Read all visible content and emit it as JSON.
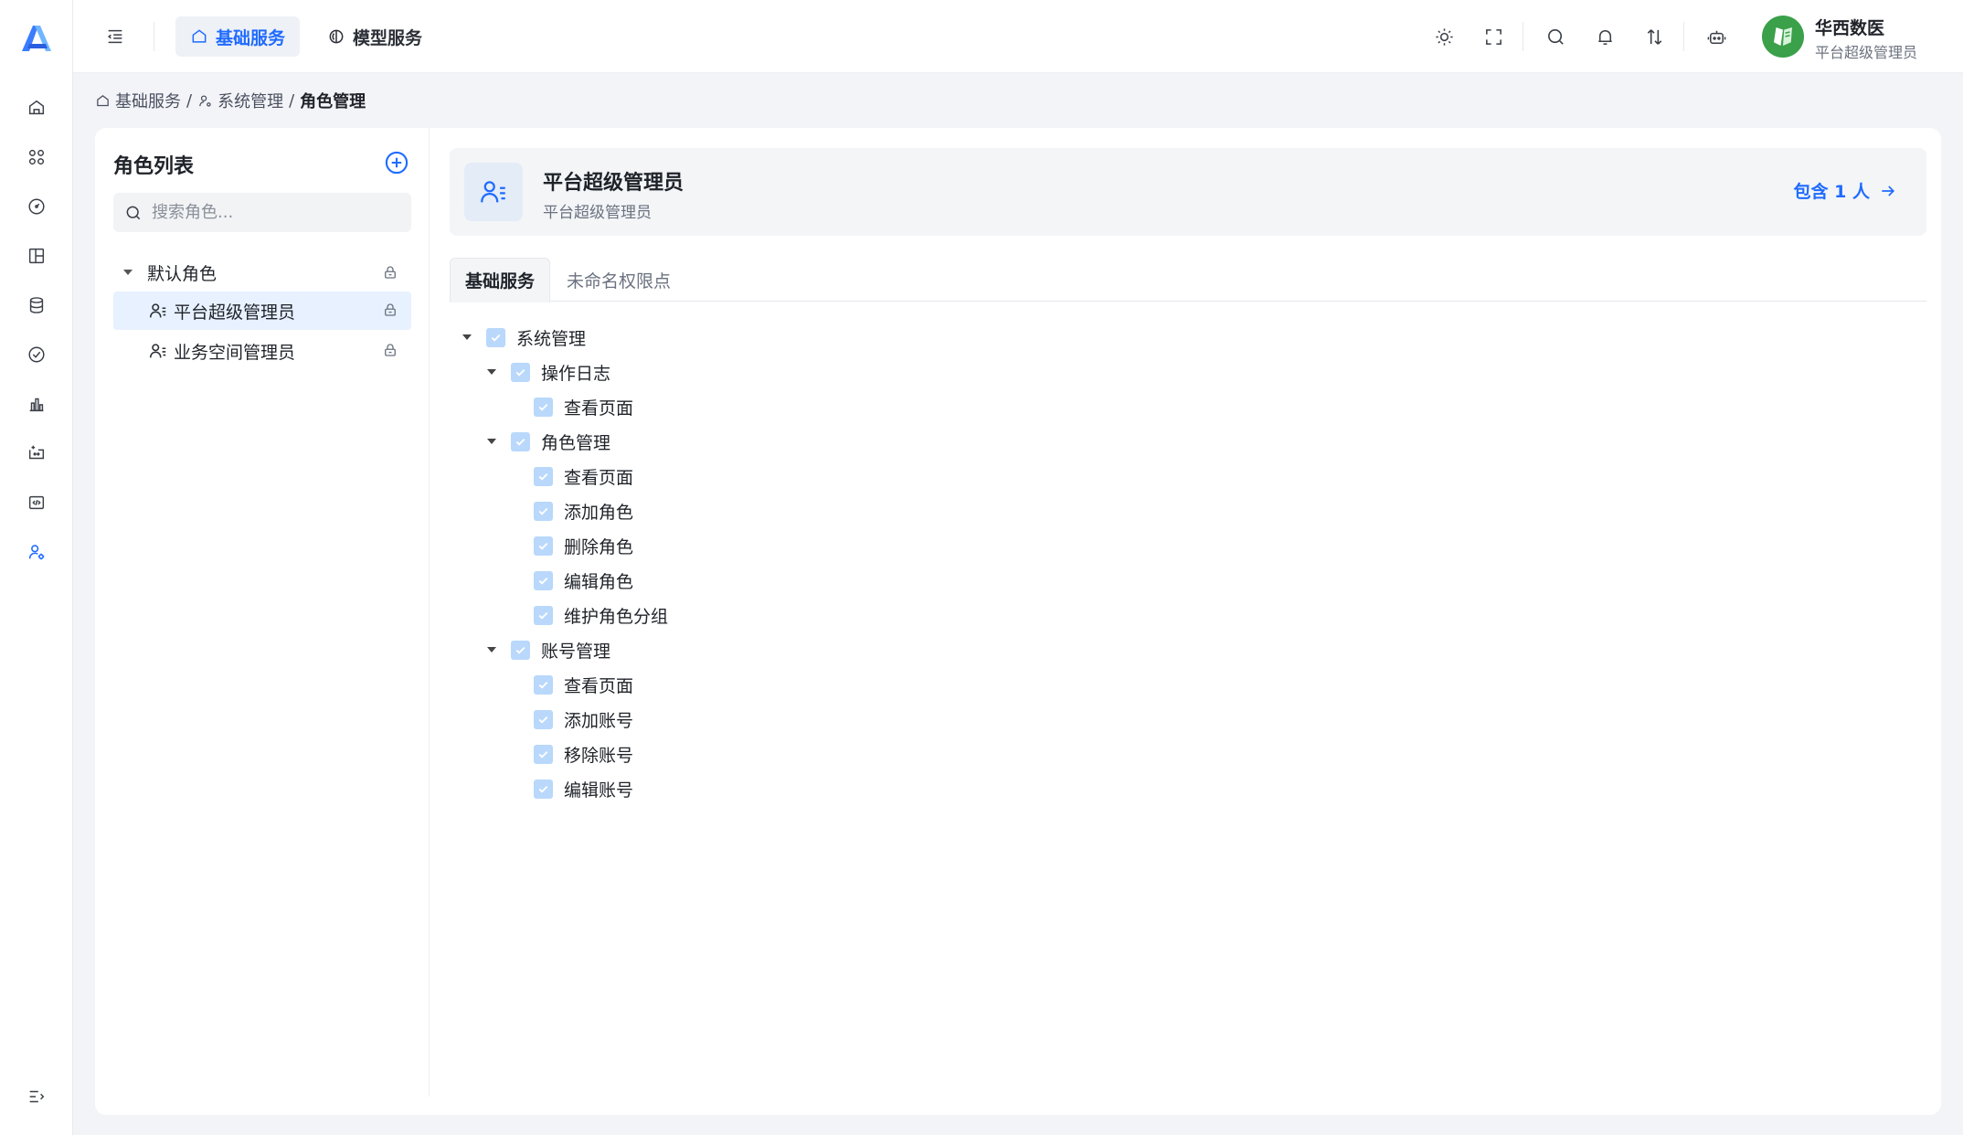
{
  "header": {
    "top_tabs": [
      {
        "label": "基础服务",
        "active": true
      },
      {
        "label": "模型服务",
        "active": false
      }
    ],
    "user": {
      "name": "华西数医",
      "role": "平台超级管理员"
    }
  },
  "breadcrumb": [
    "基础服务",
    "系统管理",
    "角色管理"
  ],
  "sidebar": {
    "icons": [
      "home-icon",
      "apps-icon",
      "dashboard-icon",
      "layout-icon",
      "database-icon",
      "check-circle-icon",
      "bar-chart-icon",
      "ticket-icon",
      "code-icon",
      "user-settings-icon"
    ],
    "active_icon": "user-settings-icon"
  },
  "role_list": {
    "title": "角色列表",
    "search_placeholder": "搜索角色...",
    "group_label": "默认角色",
    "roles": [
      {
        "label": "平台超级管理员",
        "selected": true
      },
      {
        "label": "业务空间管理员",
        "selected": false
      }
    ]
  },
  "role_detail": {
    "title": "平台超级管理员",
    "subtitle": "平台超级管理员",
    "members_link": "包含 1 人",
    "tabs": [
      {
        "label": "基础服务",
        "active": true
      },
      {
        "label": "未命名权限点",
        "active": false
      }
    ]
  },
  "permissions": {
    "root": "系统管理",
    "groups": [
      {
        "label": "操作日志",
        "items": [
          "查看页面"
        ]
      },
      {
        "label": "角色管理",
        "items": [
          "查看页面",
          "添加角色",
          "删除角色",
          "编辑角色",
          "维护角色分组"
        ]
      },
      {
        "label": "账号管理",
        "items": [
          "查看页面",
          "添加账号",
          "移除账号",
          "编辑账号"
        ]
      }
    ]
  },
  "colors": {
    "accent": "#1f6bff",
    "selected_bg": "#e8f1ff",
    "checkbox": "#b9d8fb",
    "avatar": "#3aa04a"
  }
}
